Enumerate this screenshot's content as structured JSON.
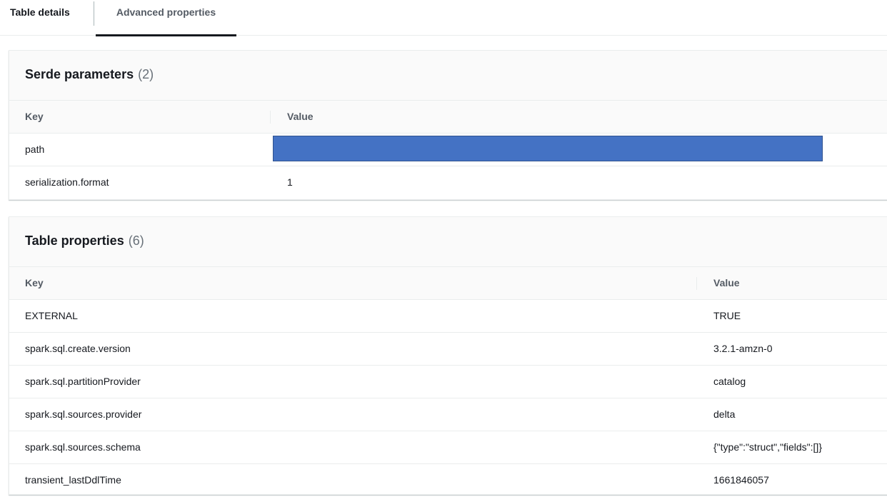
{
  "tabs": [
    {
      "label": "Table details",
      "active": false
    },
    {
      "label": "Advanced properties",
      "active": true
    }
  ],
  "serde": {
    "title": "Serde parameters",
    "count": "(2)",
    "columns": {
      "key": "Key",
      "value": "Value"
    },
    "rows": [
      {
        "key": "path",
        "value": ""
      },
      {
        "key": "serialization.format",
        "value": "1"
      }
    ]
  },
  "table_properties": {
    "title": "Table properties",
    "count": "(6)",
    "columns": {
      "key": "Key",
      "value": "Value"
    },
    "rows": [
      {
        "key": "EXTERNAL",
        "value": "TRUE"
      },
      {
        "key": "spark.sql.create.version",
        "value": "3.2.1-amzn-0"
      },
      {
        "key": "spark.sql.partitionProvider",
        "value": "catalog"
      },
      {
        "key": "spark.sql.sources.provider",
        "value": "delta"
      },
      {
        "key": "spark.sql.sources.schema",
        "value": "{\"type\":\"struct\",\"fields\":[]}"
      },
      {
        "key": "transient_lastDdlTime",
        "value": "1661846057"
      }
    ]
  },
  "colors": {
    "redaction": "#4472c4",
    "active_tab_underline": "#16191f"
  }
}
